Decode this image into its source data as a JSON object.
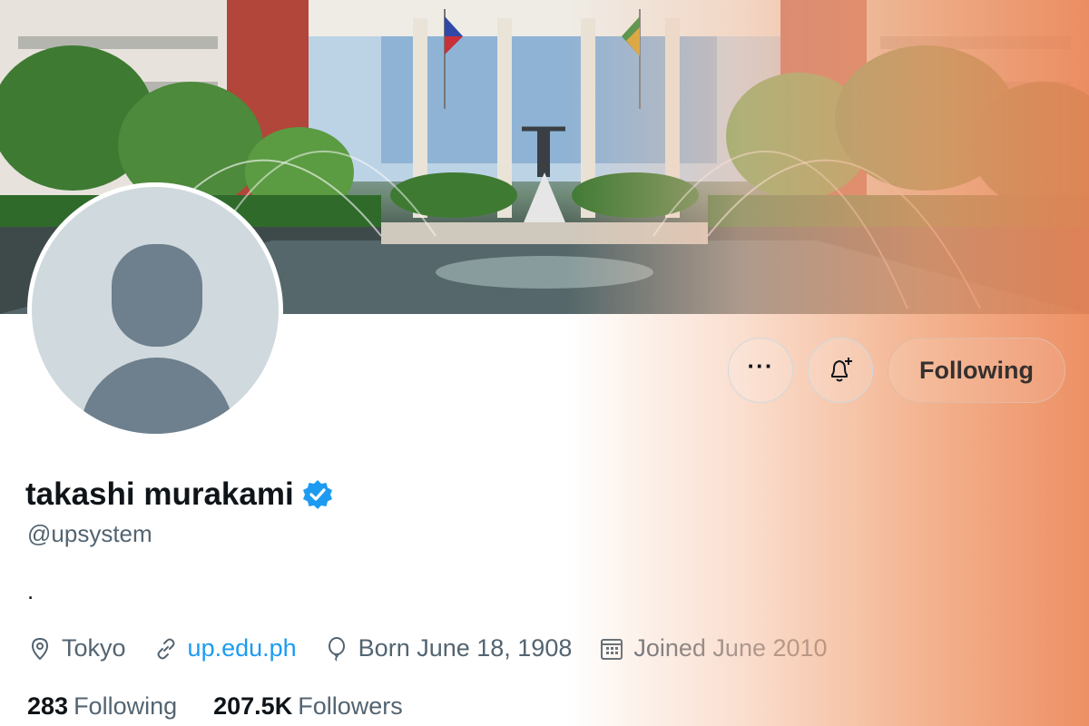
{
  "profile": {
    "display_name": "takashi murakami",
    "handle": "@upsystem",
    "bio": ".",
    "verified": true
  },
  "actions": {
    "more_icon": "more-horizontal-icon",
    "notify_icon": "bell-plus-icon",
    "following_label": "Following"
  },
  "meta": {
    "location": "Tokyo",
    "website": "up.edu.ph",
    "birthday": "Born June 18, 1908",
    "joined": "Joined June 2010"
  },
  "stats": {
    "following_count": "283",
    "following_label": "Following",
    "followers_count": "207.5K",
    "followers_label": "Followers"
  },
  "colors": {
    "accent": "#1d9bf0",
    "secondary_text": "#536471",
    "avatar_bg": "#cfd9de",
    "avatar_silhouette": "#6e7f8d",
    "overlay_warm": "#ec8658"
  }
}
